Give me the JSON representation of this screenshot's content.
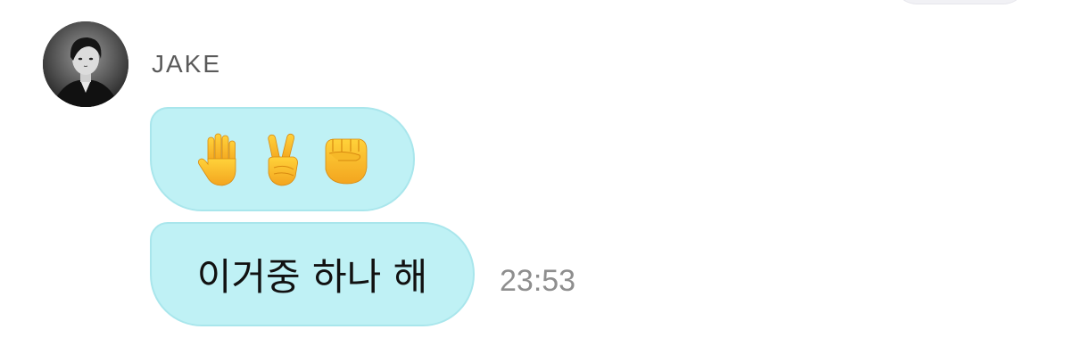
{
  "message": {
    "sender": "JAKE",
    "emoji_icons": [
      "raised-hand-icon",
      "victory-hand-icon",
      "raised-fist-icon"
    ],
    "text": "이거중 하나 해",
    "time": "23:53"
  },
  "colors": {
    "bubble": "#bff1f5",
    "bubble_border": "#a9e6ec",
    "timestamp": "#8e8e8e",
    "sender": "#5a5a5a"
  }
}
